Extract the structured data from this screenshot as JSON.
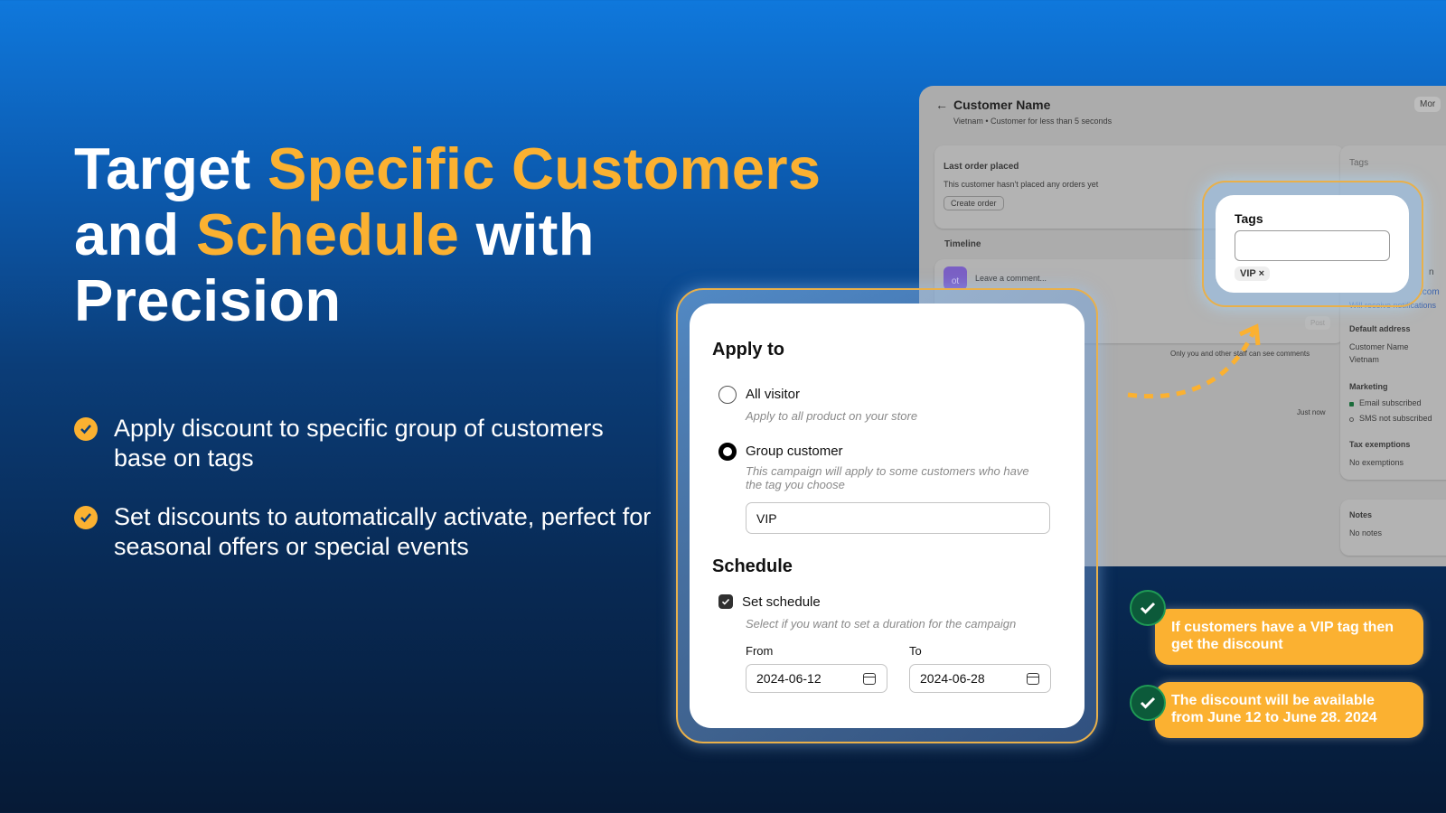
{
  "hero": {
    "line1_a": "Target ",
    "line1_b": "Specific Customers",
    "line2_a": "and ",
    "line2_b": "Schedule",
    "line2_c": " with",
    "line3": "Precision"
  },
  "bullets": [
    "Apply discount to specific group of customers base on tags",
    "Set discounts to automatically activate, perfect for seasonal offers or special events"
  ],
  "customer_page": {
    "title": "Customer Name",
    "subtitle": "Vietnam • Customer for less than 5 seconds",
    "more_button": "Mor",
    "last_order": {
      "heading": "Last order placed",
      "text": "This customer hasn't placed any orders yet",
      "button": "Create order"
    },
    "timeline": {
      "heading": "Timeline",
      "avatar": "ot",
      "placeholder": "Leave a comment...",
      "post": "Post",
      "note": "Only you and other staff can see comments",
      "time": "Just now"
    },
    "sidebar": {
      "tags": "Tags",
      "contact_partial": "n",
      "email_partial": ".com",
      "notify": "Will receive notifications",
      "default_address": "Default address",
      "address_name": "Customer Name",
      "address_country": "Vietnam",
      "marketing": "Marketing",
      "email_sub": "Email subscribed",
      "sms_sub": "SMS not subscribed",
      "tax": "Tax exemptions",
      "tax_value": "No exemptions",
      "notes": "Notes",
      "notes_value": "No notes"
    }
  },
  "tags_popup": {
    "title": "Tags",
    "input_value": "",
    "chip": "VIP"
  },
  "form": {
    "apply_to": "Apply to",
    "all_visitor": {
      "label": "All visitor",
      "hint": "Apply to all product on your store",
      "selected": false
    },
    "group_customer": {
      "label": "Group customer",
      "hint1": "This campaign will apply to some customers who have",
      "hint2": "the tag you choose",
      "selected": true,
      "tag_value": "VIP"
    },
    "schedule": "Schedule",
    "set_schedule": {
      "label": "Set schedule",
      "checked": true,
      "hint": "Select if you want to set a duration for the campaign"
    },
    "from_label": "From",
    "from_value": "2024-06-12",
    "to_label": "To",
    "to_value": "2024-06-28"
  },
  "notes": [
    "If customers have a VIP tag then get the discount",
    "The discount will be available from June 12 to June 28. 2024"
  ],
  "colors": {
    "accent": "#fbb131",
    "check_green": "#0c5a3a"
  }
}
